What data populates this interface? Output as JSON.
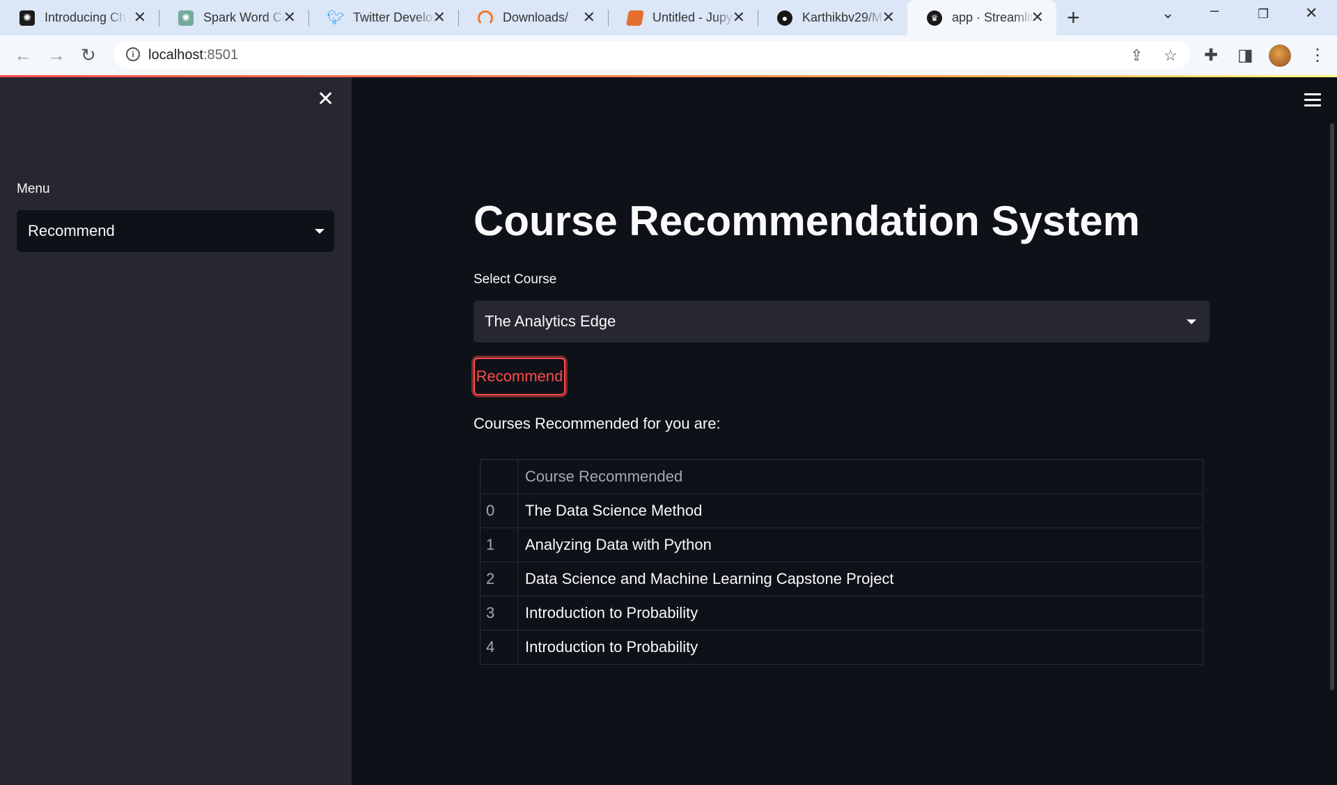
{
  "browser": {
    "tabs": [
      {
        "label": "Introducing ChatGPT",
        "icon": "openai-icon",
        "color": "#1a1a1a"
      },
      {
        "label": "Spark Word Count",
        "icon": "chatgpt-icon",
        "color": "#74aa9c"
      },
      {
        "label": "Twitter Developer",
        "icon": "twitter-icon",
        "color": "#1d9bf0"
      },
      {
        "label": "Downloads/",
        "icon": "jupyter-spinner-icon",
        "color": "#f37726"
      },
      {
        "label": "Untitled - Jupyter",
        "icon": "jupyter-book-icon",
        "color": "#e46e2e"
      },
      {
        "label": "Karthikbv29/M",
        "icon": "github-icon",
        "color": "#181717"
      },
      {
        "label": "app · Streamlit",
        "icon": "streamlit-icon",
        "color": "#1a1a1a"
      }
    ],
    "url_host": "localhost",
    "url_port": ":8501"
  },
  "sidebar": {
    "menu_label": "Menu",
    "menu_value": "Recommend"
  },
  "main": {
    "title": "Course Recommendation System",
    "select_label": "Select Course",
    "select_value": "The Analytics Edge",
    "button_label": "Recommend",
    "result_label": "Courses Recommended for you are:",
    "table": {
      "header": "Course Recommended",
      "rows": [
        {
          "index": "0",
          "course": "The Data Science Method"
        },
        {
          "index": "1",
          "course": "Analyzing Data with Python"
        },
        {
          "index": "2",
          "course": "Data Science and Machine Learning Capstone Project"
        },
        {
          "index": "3",
          "course": "Introduction to Probability"
        },
        {
          "index": "4",
          "course": "Introduction to Probability"
        }
      ]
    }
  },
  "colors": {
    "accent": "#ff4b4b",
    "background": "#0e1117",
    "sidebar": "#262730"
  }
}
